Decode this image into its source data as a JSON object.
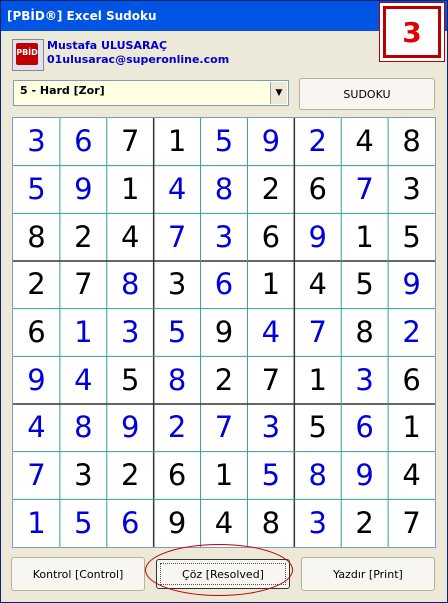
{
  "window": {
    "title": "[PBİD®] Excel Sudoku"
  },
  "level_indicator": "3",
  "header": {
    "logo": "PBİD",
    "author": "Mustafa ULUSARAÇ",
    "email": "01ulusarac@superonline.com"
  },
  "level_select": {
    "value": "5 - Hard [Zor]"
  },
  "buttons": {
    "sudoku": "SUDOKU",
    "control": "Kontrol [Control]",
    "resolve": "Çöz [Resolved]",
    "print": "Yazdır [Print]"
  },
  "colors": {
    "given": "#000000",
    "solved": "#0000dd",
    "grid_line": "#3a9c96",
    "accent_red": "#c00000"
  },
  "board": {
    "rows": [
      [
        3,
        6,
        7,
        1,
        5,
        9,
        2,
        4,
        8
      ],
      [
        5,
        9,
        1,
        4,
        8,
        2,
        6,
        7,
        3
      ],
      [
        8,
        2,
        4,
        7,
        3,
        6,
        9,
        1,
        5
      ],
      [
        2,
        7,
        8,
        3,
        6,
        1,
        4,
        5,
        9
      ],
      [
        6,
        1,
        3,
        5,
        9,
        4,
        7,
        8,
        2
      ],
      [
        9,
        4,
        5,
        8,
        2,
        7,
        1,
        3,
        6
      ],
      [
        4,
        8,
        9,
        2,
        7,
        3,
        5,
        6,
        1
      ],
      [
        7,
        3,
        2,
        6,
        1,
        5,
        8,
        9,
        4
      ],
      [
        1,
        5,
        6,
        9,
        4,
        8,
        3,
        2,
        7
      ]
    ],
    "solved_mask": [
      [
        1,
        1,
        0,
        0,
        1,
        1,
        1,
        0,
        0
      ],
      [
        1,
        1,
        0,
        1,
        1,
        0,
        0,
        1,
        0
      ],
      [
        0,
        0,
        0,
        1,
        1,
        0,
        1,
        0,
        0
      ],
      [
        0,
        0,
        1,
        0,
        1,
        0,
        0,
        0,
        1
      ],
      [
        0,
        1,
        1,
        1,
        0,
        1,
        1,
        0,
        1
      ],
      [
        1,
        1,
        0,
        1,
        0,
        0,
        0,
        1,
        0
      ],
      [
        1,
        1,
        1,
        1,
        1,
        1,
        0,
        1,
        0
      ],
      [
        1,
        0,
        0,
        0,
        0,
        1,
        1,
        1,
        0
      ],
      [
        1,
        1,
        1,
        0,
        0,
        0,
        1,
        0,
        0
      ]
    ]
  }
}
